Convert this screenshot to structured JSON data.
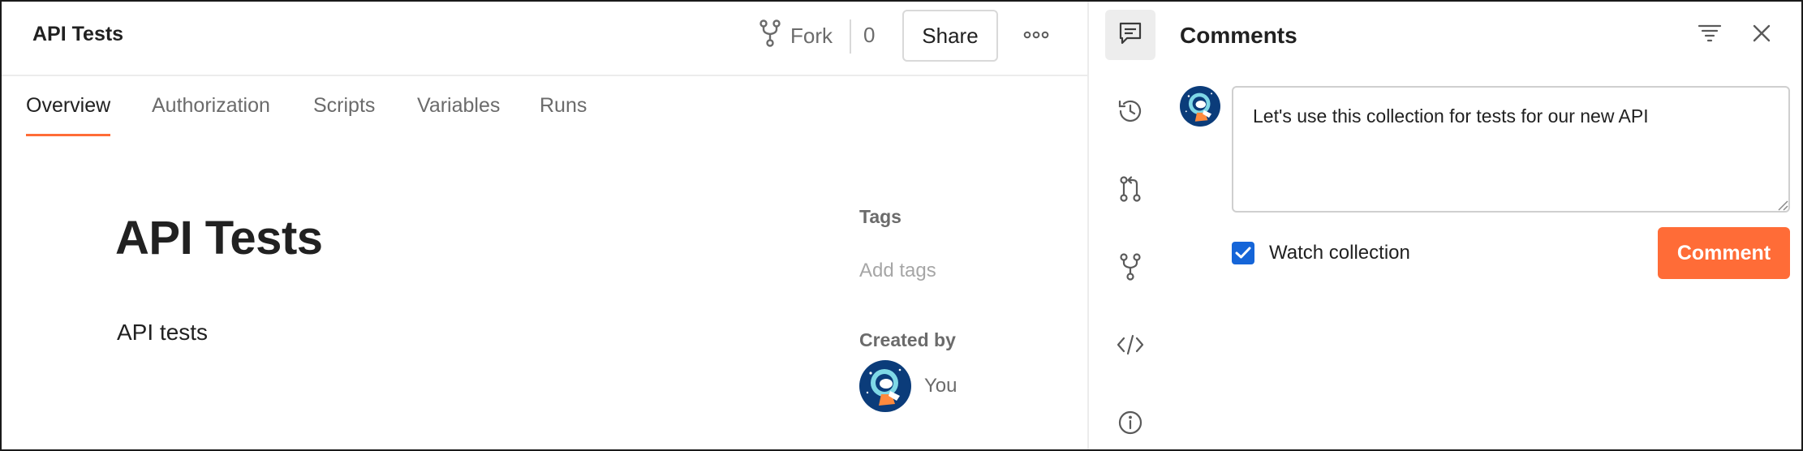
{
  "header": {
    "collection_title": "API Tests",
    "fork_label": "Fork",
    "fork_count": "0",
    "share_label": "Share",
    "more_icon": "more-horizontal-icon",
    "fork_icon": "fork-icon"
  },
  "tabs": [
    {
      "label": "Overview",
      "active": true
    },
    {
      "label": "Authorization",
      "active": false
    },
    {
      "label": "Scripts",
      "active": false
    },
    {
      "label": "Variables",
      "active": false
    },
    {
      "label": "Runs",
      "active": false
    }
  ],
  "overview": {
    "title": "API Tests",
    "description": "API tests",
    "tags_label": "Tags",
    "add_tags_label": "Add tags",
    "created_by_label": "Created by",
    "creator_name": "You"
  },
  "rail": [
    {
      "icon": "comments-icon",
      "active": true
    },
    {
      "icon": "history-icon",
      "active": false
    },
    {
      "icon": "pull-request-icon",
      "active": false
    },
    {
      "icon": "fork-icon",
      "active": false
    },
    {
      "icon": "code-icon",
      "active": false
    },
    {
      "icon": "info-icon",
      "active": false
    }
  ],
  "comments": {
    "title": "Comments",
    "filter_icon": "filter-icon",
    "close_icon": "close-icon",
    "draft_text": "Let's use this collection for tests for our new API",
    "watch_label": "Watch collection",
    "watch_checked": true,
    "submit_label": "Comment"
  },
  "colors": {
    "accent": "#ff6c37",
    "checkbox": "#1565d8",
    "avatar_bg": "#0b3c7a",
    "avatar_face": "#7fd8e6"
  }
}
